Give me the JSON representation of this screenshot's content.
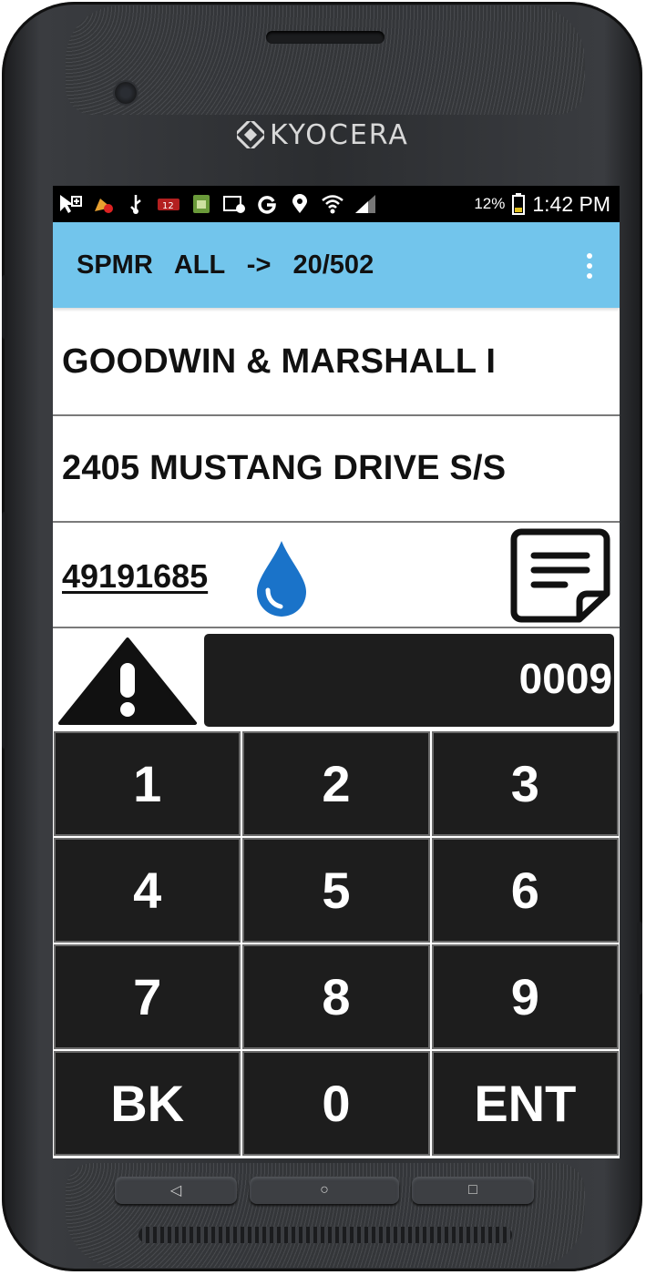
{
  "device": {
    "brand": "KYOCERA"
  },
  "status_bar": {
    "battery": "12%",
    "time": "1:42 PM",
    "icons": [
      "cursor-plus-icon",
      "app-update-icon",
      "usb-icon",
      "battery-alert-icon",
      "sim-icon",
      "gallery-icon",
      "google-icon",
      "location-icon",
      "wifi-icon",
      "signal-icon",
      "battery-icon"
    ]
  },
  "app_bar": {
    "title": "SPMR  ALL  ->  20/502"
  },
  "customer": {
    "name": "GOODWIN & MARSHALL I",
    "address": "2405 MUSTANG DRIVE S/S",
    "meter_number": "49191685"
  },
  "reading": {
    "value": "0009"
  },
  "keypad": {
    "keys": [
      "1",
      "2",
      "3",
      "4",
      "5",
      "6",
      "7",
      "8",
      "9",
      "BK",
      "0",
      "ENT"
    ]
  },
  "nav": {
    "back": "◁",
    "home": "○",
    "recents": "□"
  },
  "colors": {
    "app_bar": "#72c5ec",
    "drop": "#1a73c9",
    "key_bg": "#1d1d1d"
  }
}
